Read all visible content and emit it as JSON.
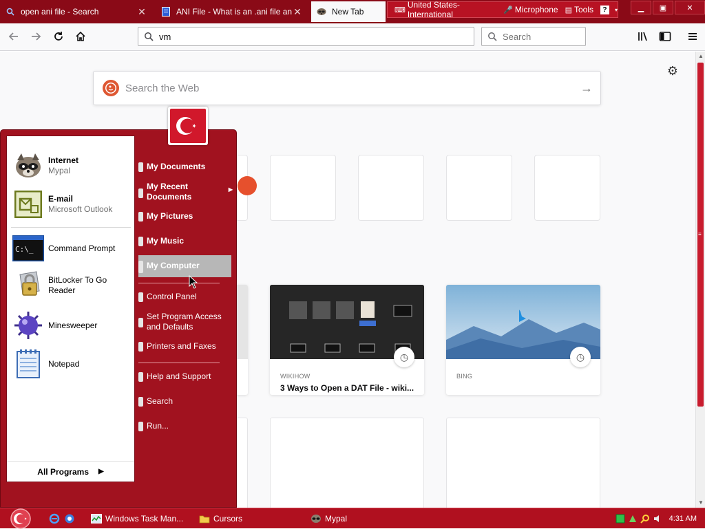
{
  "tabs": [
    {
      "title": "open ani file - Search",
      "icon": "search-icon",
      "close": "✕"
    },
    {
      "title": "ANI File - What is an .ani file an",
      "icon": "document-icon",
      "close": "✕"
    },
    {
      "title": "New Tab",
      "icon": "raccoon-icon",
      "close": "✕"
    }
  ],
  "language_bar": {
    "layout": "United States-International",
    "microphone": "Microphone",
    "tools": "Tools"
  },
  "window_controls": {
    "minimize": "▁",
    "restore": "▣",
    "close": "✕"
  },
  "navbar": {
    "url_value": "vm",
    "search_placeholder": "Search"
  },
  "newtab": {
    "web_search_placeholder": "Search the Web",
    "highlights": [
      {
        "source": "WIKIHOW",
        "title": "3 Ways to Open a DAT File - wiki..."
      },
      {
        "source": "BING",
        "title": ""
      }
    ]
  },
  "start_menu": {
    "pinned": [
      {
        "title": "Internet",
        "subtitle": "Mypal"
      },
      {
        "title": "E-mail",
        "subtitle": "Microsoft Outlook"
      }
    ],
    "recent": [
      {
        "label": "Command Prompt"
      },
      {
        "label": "BitLocker To Go Reader"
      },
      {
        "label": "Minesweeper"
      },
      {
        "label": "Notepad"
      }
    ],
    "all_programs": "All Programs",
    "places": [
      {
        "label": "My Documents"
      },
      {
        "label": "My Recent Documents"
      },
      {
        "label": "My Pictures"
      },
      {
        "label": "My Music"
      },
      {
        "label": "My Computer"
      }
    ],
    "system": [
      {
        "label": "Control Panel"
      },
      {
        "label": "Set Program Access and Defaults"
      },
      {
        "label": "Printers and Faxes"
      }
    ],
    "help": [
      {
        "label": "Help and Support"
      },
      {
        "label": "Search"
      },
      {
        "label": "Run..."
      }
    ]
  },
  "taskbar": {
    "buttons": [
      {
        "label": "Windows Task Man..."
      },
      {
        "label": "Cursors"
      },
      {
        "label": "Mypal"
      }
    ],
    "clock": "4:31 AM"
  },
  "colors": {
    "theme_red": "#a1121f",
    "selected_gray": "#b7b7b7"
  }
}
